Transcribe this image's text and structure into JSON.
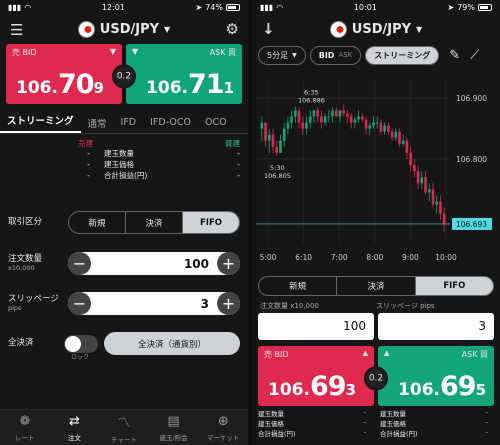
{
  "left": {
    "status": {
      "time": "12:01",
      "battery": "74%"
    },
    "header": {
      "pair": "USD/JPY"
    },
    "bid": {
      "label": "売 BID",
      "small": "106.",
      "big": "70",
      "tail": "9"
    },
    "ask": {
      "label": "ASK 買",
      "small": "106.",
      "big": "71",
      "tail": "1"
    },
    "spread": "0.2",
    "tabs": [
      "ストリーミング",
      "通常",
      "IFD",
      "IFD-OCO",
      "OCO"
    ],
    "positions": {
      "sell_label": "売建",
      "buy_label": "買建",
      "rows": [
        {
          "key": "建玉数量",
          "sell": "-",
          "buy": "-"
        },
        {
          "key": "建玉価格",
          "sell": "-",
          "buy": "-"
        },
        {
          "key": "合計損益(円)",
          "sell": "-",
          "buy": "-"
        }
      ]
    },
    "order_type": {
      "label": "取引区分",
      "options": [
        "新規",
        "決済",
        "FIFO"
      ]
    },
    "quantity": {
      "label": "注文数量",
      "sub": "x10,000",
      "value": "100"
    },
    "slippage": {
      "label": "スリッページ",
      "sub": "pips",
      "value": "3"
    },
    "close_all": {
      "label": "全決済",
      "lock": "ロック",
      "button": "全決済（通貨別）"
    },
    "nav": [
      {
        "label": "レート",
        "icon": "rate-icon"
      },
      {
        "label": "注文",
        "icon": "order-icon"
      },
      {
        "label": "チャート",
        "icon": "chart-icon"
      },
      {
        "label": "建玉/照会",
        "icon": "position-icon"
      },
      {
        "label": "マーケット",
        "icon": "market-icon"
      }
    ]
  },
  "right": {
    "status": {
      "time": "10:01",
      "battery": "79%"
    },
    "header": {
      "pair": "USD/JPY"
    },
    "toolbar": {
      "interval": "5分足",
      "price_type": "BID",
      "price_type_sub": "ASK",
      "mode": "ストリーミング"
    },
    "order_type": {
      "options": [
        "新規",
        "決済",
        "FIFO"
      ]
    },
    "fields": {
      "quantity_label": "注文数量 x10,000",
      "slippage_label": "スリッページ pips",
      "quantity": "100",
      "slippage": "3"
    },
    "bid": {
      "label": "売 BID",
      "small": "106.",
      "big": "69",
      "tail": "3"
    },
    "ask": {
      "label": "ASK 買",
      "small": "106.",
      "big": "69",
      "tail": "5"
    },
    "spread": "0.2",
    "positions": {
      "rows_left": [
        {
          "key": "建玉数量",
          "val": "-"
        },
        {
          "key": "建玉価格",
          "val": "-"
        },
        {
          "key": "合計損益(円)",
          "val": "-"
        }
      ],
      "rows_right": [
        {
          "key": "建玉数量",
          "val": "-"
        },
        {
          "key": "建玉価格",
          "val": "-"
        },
        {
          "key": "合計損益(円)",
          "val": "-"
        }
      ]
    }
  },
  "chart_data": {
    "type": "candlestick",
    "x_ticks": [
      "5:00",
      "6:10",
      "7:00",
      "8:00",
      "9:00",
      "10:00"
    ],
    "y_ticks": [
      106.9,
      106.8
    ],
    "ylim": [
      106.66,
      106.93
    ],
    "annotations": [
      {
        "text": "6:35",
        "value": "106.886"
      },
      {
        "text": "5:30",
        "value": "106.805"
      }
    ],
    "current_price": "106.693",
    "up_color": "#13a57a",
    "down_color": "#e0294f",
    "candles": [
      [
        106.85,
        106.87,
        106.83,
        106.86
      ],
      [
        106.86,
        106.86,
        106.82,
        106.83
      ],
      [
        106.83,
        106.85,
        106.81,
        106.84
      ],
      [
        106.84,
        106.85,
        106.81,
        106.82
      ],
      [
        106.82,
        106.83,
        106.805,
        106.81
      ],
      [
        106.81,
        106.84,
        106.81,
        106.83
      ],
      [
        106.83,
        106.86,
        106.82,
        106.85
      ],
      [
        106.85,
        106.87,
        106.84,
        106.86
      ],
      [
        106.86,
        106.88,
        106.85,
        106.87
      ],
      [
        106.87,
        106.886,
        106.86,
        106.88
      ],
      [
        106.88,
        106.885,
        106.85,
        106.86
      ],
      [
        106.86,
        106.87,
        106.84,
        106.85
      ],
      [
        106.85,
        106.87,
        106.84,
        106.86
      ],
      [
        106.86,
        106.88,
        106.85,
        106.87
      ],
      [
        106.87,
        106.88,
        106.86,
        106.88
      ],
      [
        106.88,
        106.885,
        106.86,
        106.87
      ],
      [
        106.87,
        106.88,
        106.85,
        106.86
      ],
      [
        106.86,
        106.875,
        106.855,
        106.87
      ],
      [
        106.87,
        106.88,
        106.86,
        106.87
      ],
      [
        106.87,
        106.885,
        106.86,
        106.88
      ],
      [
        106.88,
        106.885,
        106.87,
        106.87
      ],
      [
        106.87,
        106.88,
        106.86,
        106.88
      ],
      [
        106.88,
        106.89,
        106.87,
        106.875
      ],
      [
        106.875,
        106.88,
        106.86,
        106.87
      ],
      [
        106.87,
        106.875,
        106.85,
        106.86
      ],
      [
        106.86,
        106.87,
        106.85,
        106.865
      ],
      [
        106.865,
        106.88,
        106.86,
        106.87
      ],
      [
        106.87,
        106.875,
        106.86,
        106.865
      ],
      [
        106.865,
        106.87,
        106.84,
        106.85
      ],
      [
        106.85,
        106.86,
        106.84,
        106.855
      ],
      [
        106.855,
        106.87,
        106.85,
        106.86
      ],
      [
        106.86,
        106.87,
        106.85,
        106.86
      ],
      [
        106.86,
        106.865,
        106.84,
        106.845
      ],
      [
        106.845,
        106.86,
        106.84,
        106.855
      ],
      [
        106.855,
        106.86,
        106.84,
        106.845
      ],
      [
        106.845,
        106.85,
        106.83,
        106.835
      ],
      [
        106.835,
        106.85,
        106.83,
        106.845
      ],
      [
        106.845,
        106.85,
        106.82,
        106.825
      ],
      [
        106.825,
        106.84,
        106.82,
        106.83
      ],
      [
        106.83,
        106.835,
        106.8,
        106.81
      ],
      [
        106.81,
        106.82,
        106.78,
        106.79
      ],
      [
        106.79,
        106.8,
        106.77,
        106.78
      ],
      [
        106.78,
        106.79,
        106.75,
        106.76
      ],
      [
        106.76,
        106.78,
        106.75,
        106.77
      ],
      [
        106.77,
        106.78,
        106.74,
        106.745
      ],
      [
        106.745,
        106.76,
        106.73,
        106.75
      ],
      [
        106.75,
        106.76,
        106.72,
        106.725
      ],
      [
        106.725,
        106.74,
        106.71,
        106.73
      ],
      [
        106.73,
        106.74,
        106.7,
        106.71
      ],
      [
        106.71,
        106.72,
        106.68,
        106.693
      ]
    ]
  }
}
